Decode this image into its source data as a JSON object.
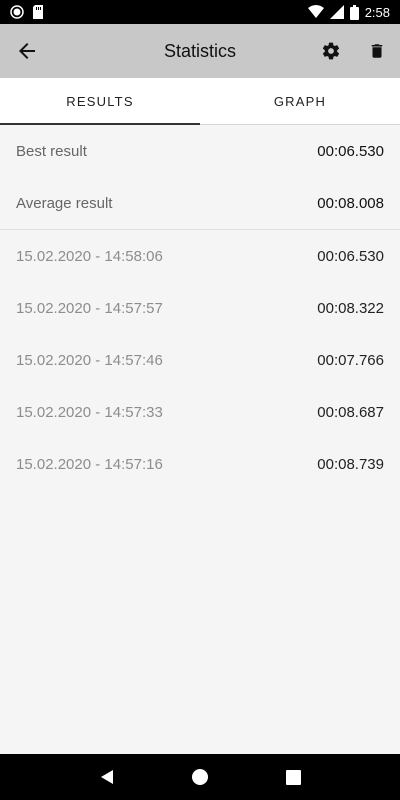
{
  "status_bar": {
    "time": "2:58"
  },
  "app_bar": {
    "title": "Statistics"
  },
  "tabs": [
    {
      "label": "RESULTS",
      "active": true
    },
    {
      "label": "GRAPH",
      "active": false
    }
  ],
  "summary": {
    "best_label": "Best result",
    "best_value": "00:06.530",
    "average_label": "Average result",
    "average_value": "00:08.008"
  },
  "results": [
    {
      "datetime": "15.02.2020 - 14:58:06",
      "time": "00:06.530"
    },
    {
      "datetime": "15.02.2020 - 14:57:57",
      "time": "00:08.322"
    },
    {
      "datetime": "15.02.2020 - 14:57:46",
      "time": "00:07.766"
    },
    {
      "datetime": "15.02.2020 - 14:57:33",
      "time": "00:08.687"
    },
    {
      "datetime": "15.02.2020 - 14:57:16",
      "time": "00:08.739"
    }
  ],
  "colors": {
    "app_bar": "#c8c8c8",
    "background": "#f5f5f5",
    "tab_indicator": "#333333"
  }
}
